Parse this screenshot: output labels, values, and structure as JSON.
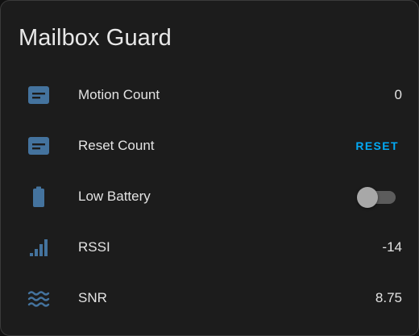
{
  "card": {
    "title": "Mailbox Guard"
  },
  "colors": {
    "icon": "#44739e",
    "accent": "#03a9f4",
    "toggle_off_track": "#5c5c5c",
    "toggle_off_thumb": "#a8a8a8"
  },
  "entities": [
    {
      "icon": "counter-box-icon",
      "name": "Motion Count",
      "value": "0"
    },
    {
      "icon": "counter-box-icon",
      "name": "Reset Count",
      "action_label": "RESET"
    },
    {
      "icon": "battery-icon",
      "name": "Low Battery",
      "toggle_on": false
    },
    {
      "icon": "signal-bars-icon",
      "name": "RSSI",
      "value": "-14"
    },
    {
      "icon": "waves-icon",
      "name": "SNR",
      "value": "8.75"
    }
  ]
}
